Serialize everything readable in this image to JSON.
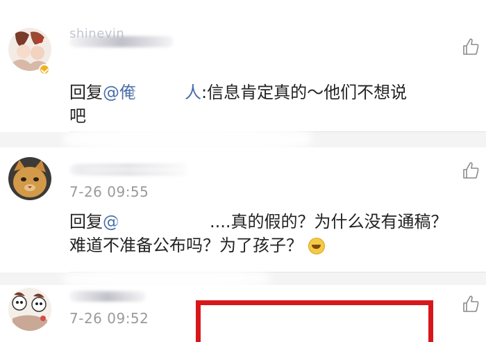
{
  "comments": [
    {
      "username": "shinevin",
      "time": "",
      "reply_prefix": "回复",
      "mention_visible_start": "@俺",
      "mention_visible_end": "人",
      "text": ":信息肯定真的～他们不想说",
      "text_line2": "吧"
    },
    {
      "username": "",
      "time": "7-26 09:55",
      "reply_prefix": "回复",
      "mention_visible_start": "@",
      "mention_visible_end": "",
      "text": "....真的假的？为什么没有通稿？",
      "text_line2": "难道不准备公布吗？为了孩子？"
    },
    {
      "username": "",
      "time": "7-26 09:52",
      "reply_prefix": "",
      "mention_visible_start": "",
      "mention_visible_end": "",
      "text": "",
      "text_line2": ""
    }
  ],
  "icons": {
    "like": "thumbs-up-icon",
    "verified": "verified-badge-icon",
    "emoji": "laughing-emoji-icon"
  },
  "colors": {
    "mention": "#4a6ea8",
    "verified": "#f2b01e",
    "highlight_frame": "#d8171b",
    "time": "#9a9a9a"
  }
}
